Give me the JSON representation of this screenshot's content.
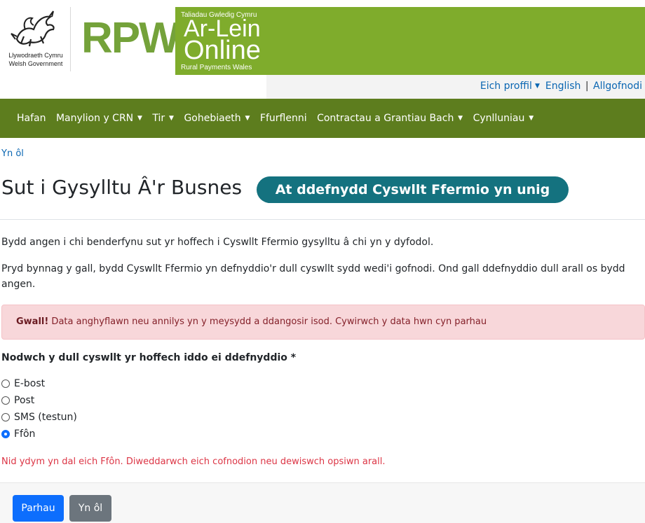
{
  "header": {
    "gov_cy": "Llywodraeth Cymru",
    "gov_en": "Welsh Government",
    "logo_text": "RPW",
    "tagline_top": "Taliadau Gwledig Cymru",
    "title_cy": "Ar-Lein",
    "title_en": "Online",
    "tagline_bottom": "Rural Payments Wales",
    "colors": {
      "logo_green": "#74a23a",
      "panel_green": "#7fac2c"
    }
  },
  "topbar": {
    "profile": "Eich proffil",
    "english": "English",
    "logout": "Allgofnodi"
  },
  "nav": {
    "items": [
      {
        "label": "Hafan",
        "dropdown": false
      },
      {
        "label": "Manylion y CRN",
        "dropdown": true
      },
      {
        "label": "Tir",
        "dropdown": true
      },
      {
        "label": "Gohebiaeth",
        "dropdown": true
      },
      {
        "label": "Ffurflenni",
        "dropdown": false
      },
      {
        "label": "Contractau a Grantiau Bach",
        "dropdown": true
      },
      {
        "label": "Cynlluniau",
        "dropdown": true
      }
    ],
    "color": "#5d7d1e"
  },
  "main": {
    "back_link": "Yn ôl",
    "title": "Sut i Gysylltu Â'r Busnes",
    "pill": "At ddefnydd Cyswllt Ffermio yn unig",
    "para1": "Bydd angen i chi benderfynu sut yr hoffech i Cyswllt Ffermio gysylltu â chi yn y dyfodol.",
    "para2": "Pryd bynnag y gall, bydd Cyswllt Ffermio yn defnyddio'r dull cyswllt sydd wedi'i gofnodi. Ond gall ddefnyddio dull arall os bydd angen.",
    "alert_strong": "Gwall!",
    "alert_text": " Data anghyflawn neu annilys yn y meysydd a ddangosir isod. Cywirwch y data hwn cyn parhau",
    "question": "Nodwch y dull cyswllt yr hoffech iddo ei ddefnyddio *",
    "options": [
      {
        "label": "E-bost",
        "checked": false
      },
      {
        "label": "Post",
        "checked": false
      },
      {
        "label": "SMS (testun)",
        "checked": false
      },
      {
        "label": "Ffôn",
        "checked": true
      }
    ],
    "error_message": "Nid ydym yn dal eich Ffôn. Diweddarwch eich cofnodion neu dewiswch opsiwn arall."
  },
  "footer": {
    "continue": "Parhau",
    "back": "Yn ôl"
  }
}
